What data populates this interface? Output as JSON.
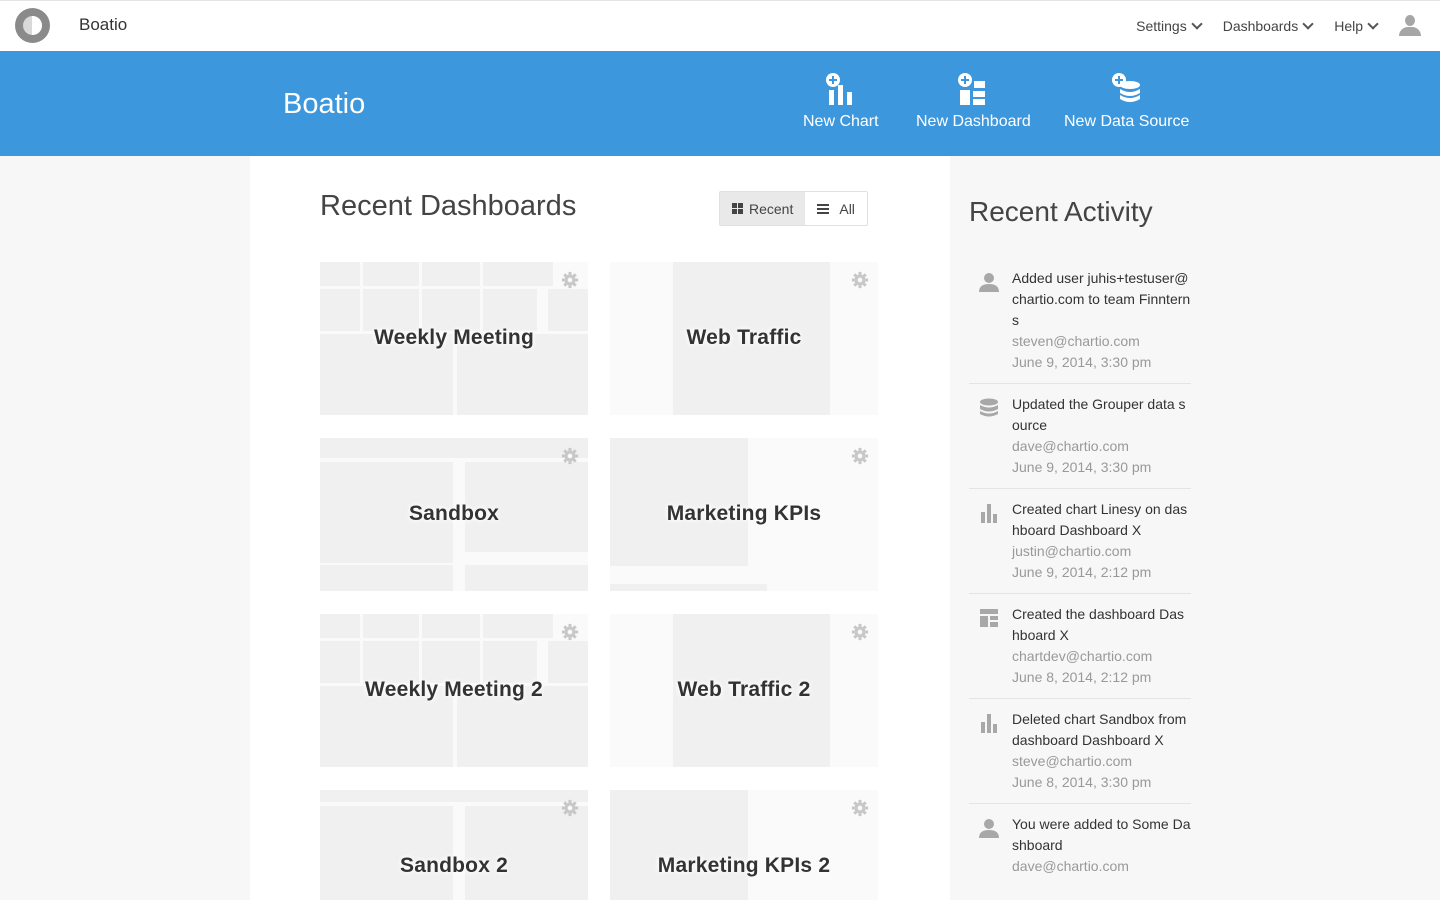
{
  "topbar": {
    "app_name": "Boatio",
    "nav": [
      {
        "label": "Settings"
      },
      {
        "label": "Dashboards"
      },
      {
        "label": "Help"
      }
    ]
  },
  "banner": {
    "title": "Boatio",
    "actions": [
      {
        "label": "New Chart",
        "icon": "new-chart-icon"
      },
      {
        "label": "New Dashboard",
        "icon": "new-dashboard-icon"
      },
      {
        "label": "New Data Source",
        "icon": "new-data-source-icon"
      }
    ],
    "color": "#3d97dc"
  },
  "main": {
    "title": "Recent Dashboards",
    "toggle": {
      "recent_label": "Recent",
      "all_label": "All",
      "selected": "Recent"
    },
    "dashboards": [
      {
        "title": "Weekly Meeting"
      },
      {
        "title": "Web Traffic"
      },
      {
        "title": "Sandbox"
      },
      {
        "title": "Marketing KPIs"
      },
      {
        "title": "Weekly Meeting 2"
      },
      {
        "title": "Web Traffic 2"
      },
      {
        "title": "Sandbox 2"
      },
      {
        "title": "Marketing KPIs 2"
      }
    ]
  },
  "activity": {
    "title": "Recent Activity",
    "items": [
      {
        "icon": "user-icon",
        "text": "Added user juhis+testuser@chartio.com to team Finnterns",
        "user": "steven@chartio.com",
        "time": "June 9, 2014,  3:30 pm"
      },
      {
        "icon": "database-icon",
        "text": "Updated the Grouper data source",
        "user": "dave@chartio.com",
        "time": "June 9, 2014, 3:30 pm"
      },
      {
        "icon": "bar-chart-icon",
        "text": "Created chart Linesy on dashboard Dashboard X",
        "user": "justin@chartio.com",
        "time": "June 9, 2014,  2:12 pm"
      },
      {
        "icon": "dashboard-icon",
        "text": "Created the dashboard Dashboard X",
        "user": "chartdev@chartio.com",
        "time": "June 8, 2014,  2:12 pm"
      },
      {
        "icon": "bar-chart-icon",
        "text": "Deleted chart Sandbox from dashboard Dashboard X",
        "user": "steve@chartio.com",
        "time": "June 8, 2014, 3:30 pm"
      },
      {
        "icon": "user-icon",
        "text": "You were added to Some Dashboard",
        "user": "dave@chartio.com",
        "time": ""
      }
    ]
  }
}
